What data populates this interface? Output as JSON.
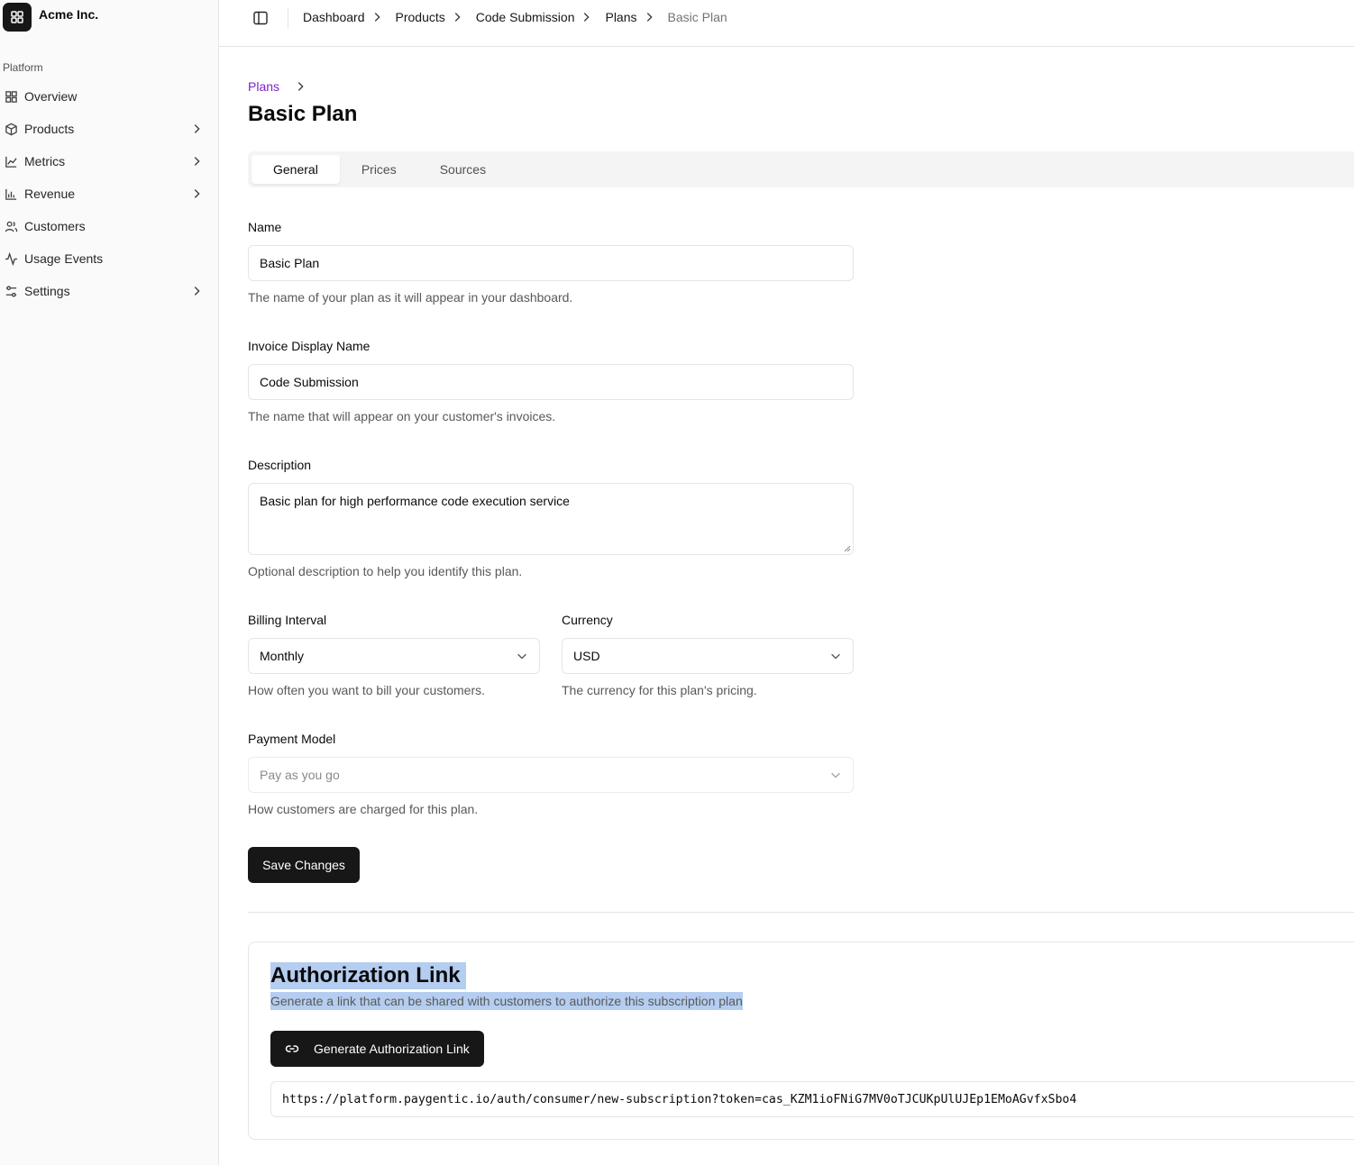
{
  "sidebar": {
    "brand": "Acme Inc.",
    "section": "Platform",
    "items": [
      {
        "label": "Overview"
      },
      {
        "label": "Products"
      },
      {
        "label": "Metrics"
      },
      {
        "label": "Revenue"
      },
      {
        "label": "Customers"
      },
      {
        "label": "Usage Events"
      },
      {
        "label": "Settings"
      }
    ]
  },
  "topbar": {
    "breadcrumbs": [
      "Dashboard",
      "Products",
      "Code Submission",
      "Plans"
    ],
    "current": "Basic Plan"
  },
  "page": {
    "back_link": "Plans",
    "title": "Basic Plan",
    "tabs": [
      "General",
      "Prices",
      "Sources"
    ]
  },
  "form": {
    "name": {
      "label": "Name",
      "value": "Basic Plan",
      "help": "The name of your plan as it will appear in your dashboard."
    },
    "invoice_name": {
      "label": "Invoice Display Name",
      "value": "Code Submission",
      "help": "The name that will appear on your customer's invoices."
    },
    "description": {
      "label": "Description",
      "value": "Basic plan for high performance code execution service",
      "help": "Optional description to help you identify this plan."
    },
    "billing_interval": {
      "label": "Billing Interval",
      "value": "Monthly",
      "help": "How often you want to bill your customers."
    },
    "currency": {
      "label": "Currency",
      "value": "USD",
      "help": "The currency for this plan's pricing."
    },
    "payment_model": {
      "label": "Payment Model",
      "value": "Pay as you go",
      "help": "How customers are charged for this plan."
    },
    "save_label": "Save Changes"
  },
  "auth_card": {
    "title": "Authorization Link",
    "description": "Generate a link that can be shared with customers to authorize this subscription plan",
    "button_label": "Generate Authorization Link",
    "url": "https://platform.paygentic.io/auth/consumer/new-subscription?token=cas_KZM1ioFNiG7MV0oTJCUKpUlUJEp1EMoAGvfxSbo4"
  },
  "colors": {
    "accent_link": "#7e22ce",
    "primary_button": "#171717",
    "selection_highlight": "#b4cdf0"
  }
}
